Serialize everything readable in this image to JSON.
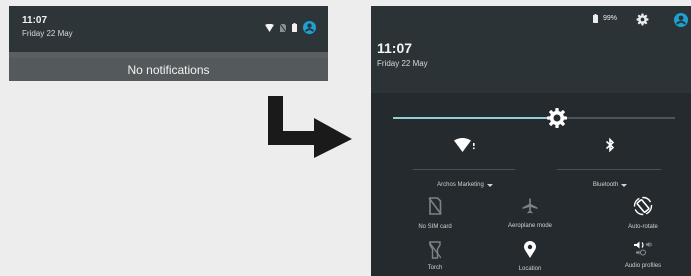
{
  "left_panel": {
    "time": "11:07",
    "date": "Friday 22 May",
    "status_icons": [
      "wifi-icon",
      "no-sim-icon",
      "battery-icon",
      "user-icon"
    ],
    "notification_text": "No notifications"
  },
  "right_panel": {
    "battery_percent": "99%",
    "time": "11:07",
    "date": "Friday 22 May",
    "brightness_level": 0.58,
    "tiles": [
      {
        "label": "Archos Marketing",
        "icon": "wifi-icon",
        "has_dropdown": true
      },
      {
        "label": "Bluetooth",
        "icon": "bluetooth-icon",
        "has_dropdown": true
      },
      {
        "label": "No SIM card",
        "icon": "no-sim-icon",
        "has_dropdown": false
      },
      {
        "label": "Aeroplane mode",
        "icon": "airplane-icon",
        "has_dropdown": false
      },
      {
        "label": "Auto-rotate",
        "icon": "auto-rotate-icon",
        "has_dropdown": false
      },
      {
        "label": "Torch",
        "icon": "torch-icon",
        "has_dropdown": false
      },
      {
        "label": "Location",
        "icon": "location-icon",
        "has_dropdown": false
      },
      {
        "label": "Audio profiles",
        "icon": "audio-profiles-icon",
        "has_dropdown": false
      }
    ]
  },
  "colors": {
    "background": "#ededed",
    "shade": "#242a2d",
    "accent": "#8fd0d3",
    "user_icon": "#1ba1d5",
    "arrow": "#1a1a1a"
  }
}
